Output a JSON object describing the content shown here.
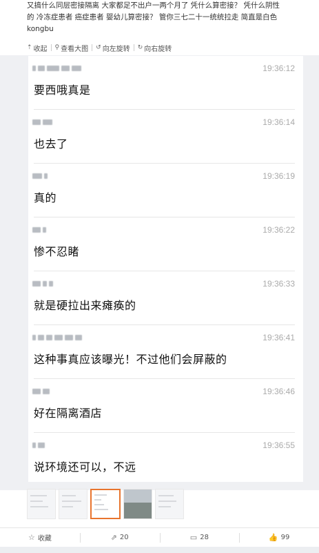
{
  "post": {
    "text_line1": "又搞什么同层密接隔离 大家都足不出户一两个月了 凭什么算密接？ 凭什么阴性",
    "text_line2": "的 冷冻症患者 癌症患者 婴幼儿算密接？ 管你三七二十一统统拉走 简直是白色",
    "text_line3": "kongbu"
  },
  "toolbar": {
    "collapse_label": "收起",
    "view_large_label": "查看大图",
    "rotate_left_label": "向左旋转",
    "rotate_right_label": "向右旋转",
    "icons": [
      "collapse-icon",
      "magnifier-icon",
      "rotate-left-icon",
      "rotate-right-icon"
    ]
  },
  "messages": [
    {
      "time": "19:36:12",
      "text": "要西哦真是"
    },
    {
      "time": "19:36:14",
      "text": "也去了"
    },
    {
      "time": "19:36:19",
      "text": "真的"
    },
    {
      "time": "19:36:22",
      "text": "惨不忍睹"
    },
    {
      "time": "19:36:33",
      "text": "就是硬拉出来瘫痪的"
    },
    {
      "time": "19:36:41",
      "text": "这种事真应该曝光！不过他们会屏蔽的"
    },
    {
      "time": "19:36:46",
      "text": "好在隔离酒店"
    },
    {
      "time": "19:36:55",
      "text": "说环境还可以，不远"
    }
  ],
  "footer": {
    "favorite_label": "收藏",
    "repost_count": "20",
    "comment_count": "28",
    "like_count": "99",
    "icons": [
      "star-icon",
      "repost-icon",
      "comment-icon",
      "thumbs-up-icon"
    ]
  },
  "colors": {
    "accent_selected_thumb": "#e8742d",
    "timestamp": "#aaaaaa",
    "picture_background": "#eff0f3"
  }
}
